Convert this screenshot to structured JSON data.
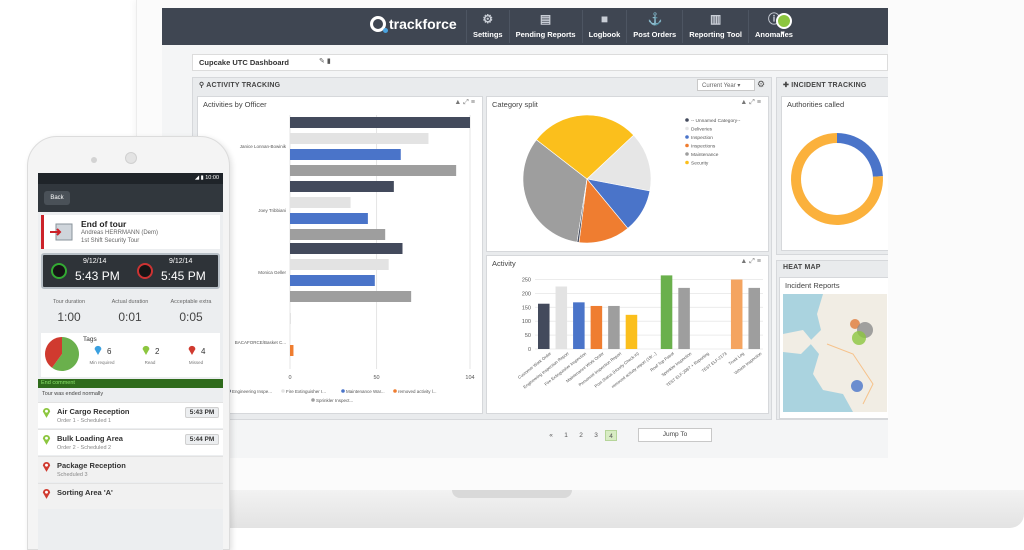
{
  "nav": {
    "brand": "trackforce",
    "items": [
      {
        "label": "Settings",
        "icon": "gear-icon"
      },
      {
        "label": "Pending Reports",
        "icon": "document-icon"
      },
      {
        "label": "Logbook",
        "icon": "book-icon"
      },
      {
        "label": "Post Orders",
        "icon": "post-orders-icon"
      },
      {
        "label": "Reporting Tool",
        "icon": "bar-chart-icon"
      },
      {
        "label": "Anomalies",
        "icon": "alert-icon"
      }
    ]
  },
  "dashboard": {
    "title": "Cupcake UTC Dashboard"
  },
  "activity_tracking": {
    "header": "ACTIVITY TRACKING",
    "period": "Current Year",
    "pager": {
      "pages": [
        "1",
        "2",
        "3",
        "4"
      ],
      "active": "4",
      "prev": "«",
      "jump_label": "Jump To"
    }
  },
  "incident_tracking": {
    "header": "INCIDENT TRACKING",
    "authorities_title": "Authorities called"
  },
  "heat_map": {
    "header": "HEAT MAP",
    "title": "Incident Reports"
  },
  "chart_data": [
    {
      "type": "bar",
      "title": "Activities by Officer",
      "orientation": "horizontal",
      "officer_labels": [
        "Janice Lonnan-Bowinik",
        "Joey Tribbiani",
        "Monica Geller",
        "BACAFORCE/Basket C..."
      ],
      "x_ticks": [
        "0",
        "50",
        "104"
      ],
      "xlim": [
        0,
        104
      ],
      "legend": [
        "Engineering Inspe...",
        "Fire Extinguisher I...",
        "Maintenance War...",
        "removed activity l...",
        "Sprinkler Inspect..."
      ],
      "series": [
        {
          "color": "#434a5c",
          "values": [
            104,
            60,
            65,
            0
          ]
        },
        {
          "color": "#e3e3e3",
          "values": [
            80,
            35,
            57,
            0
          ]
        },
        {
          "color": "#4a74c9",
          "values": [
            64,
            45,
            49,
            0
          ]
        },
        {
          "color": "#9e9e9e",
          "values": [
            96,
            55,
            70,
            0
          ]
        }
      ],
      "tail_value": {
        "color": "#ef7d30",
        "value": 2
      }
    },
    {
      "type": "pie",
      "title": "Category split",
      "legend": [
        "-- Unnamed Category--",
        "Deliveries",
        "Inspection",
        "Inspections",
        "Maintenance",
        "Security"
      ],
      "colors": [
        "#434a5c",
        "#e6e6e6",
        "#4a74c9",
        "#ef7d30",
        "#9e9e9e",
        "#fbbf1c"
      ],
      "values": [
        0.5,
        15,
        11,
        13,
        33,
        27.5
      ]
    },
    {
      "type": "bar",
      "title": "Activity",
      "y_ticks": [
        "0",
        "50",
        "100",
        "150",
        "200",
        "250"
      ],
      "ylim": [
        0,
        270
      ],
      "categories": [
        "Customer Work Order",
        "Engineering Inspection Report",
        "Fire Extinguisher Inspection",
        "Maintenance Work Order",
        "Personnel Inspection Report",
        "Post Status (Hourly Check in)",
        "removed activity report (19/...)",
        "Roof Top Patrol",
        "Sprinkler Inspection",
        "TEST ELF-2087 + Reporting",
        "TEST ELF-2173",
        "Truck Log",
        "Vehicle Inspection"
      ],
      "values": [
        163,
        225,
        168,
        155,
        155,
        123,
        0,
        265,
        220,
        0,
        0,
        250,
        220
      ],
      "colors": [
        "#434a5c",
        "#e3e3e3",
        "#4a74c9",
        "#ef7d30",
        "#9e9e9e",
        "#fbbf1c",
        "#fbbf1c",
        "#6ab04c",
        "#9e9e9e",
        "#e3e3e3",
        "#e3e3e3",
        "#f4a460",
        "#9e9e9e"
      ]
    },
    {
      "type": "pie",
      "title": "Authorities called",
      "donut": true,
      "colors": [
        "#4a74c9",
        "#fbb13c"
      ],
      "values": [
        24,
        76
      ]
    }
  ],
  "phone": {
    "status_time": "10:00",
    "back_label": "Back",
    "tour": {
      "title": "End of tour",
      "officer": "Andreas HERRMANN (Dem)",
      "tour_name": "1st Shift Security Tour"
    },
    "start": {
      "date": "9/12/14",
      "time": "5:43 PM"
    },
    "end": {
      "date": "9/12/14",
      "time": "5:45 PM"
    },
    "durations": [
      {
        "label": "Tour duration",
        "value": "1:00"
      },
      {
        "label": "Actual duration",
        "value": "0:01"
      },
      {
        "label": "Acceptable extra",
        "value": "0:05"
      }
    ],
    "tags": {
      "title": "Tags",
      "pie_colors": [
        "#6ab04c",
        "#d03a2f"
      ],
      "pie_values": [
        60,
        40
      ],
      "items": [
        {
          "count": "6",
          "label": "Min required",
          "color": "#3aa0e0"
        },
        {
          "count": "2",
          "label": "Read",
          "color": "#8cc63f"
        },
        {
          "count": "4",
          "label": "Missed",
          "color": "#d03a2f"
        }
      ]
    },
    "end_comment_label": "End comment",
    "end_comment_text": "Tour was ended normally",
    "checkpoints": [
      {
        "name": "Air Cargo Reception",
        "sub": "Order 1 - Scheduled 1",
        "time": "5:43 PM",
        "color": "#8cc63f"
      },
      {
        "name": "Bulk Loading Area",
        "sub": "Order 2 - Scheduled 2",
        "time": "5:44 PM",
        "color": "#8cc63f"
      },
      {
        "name": "Package Reception",
        "sub": "Scheduled 3",
        "time": "",
        "color": "#d03a2f"
      },
      {
        "name": "Sorting Area 'A'",
        "sub": "",
        "time": "",
        "color": "#d03a2f"
      }
    ]
  }
}
